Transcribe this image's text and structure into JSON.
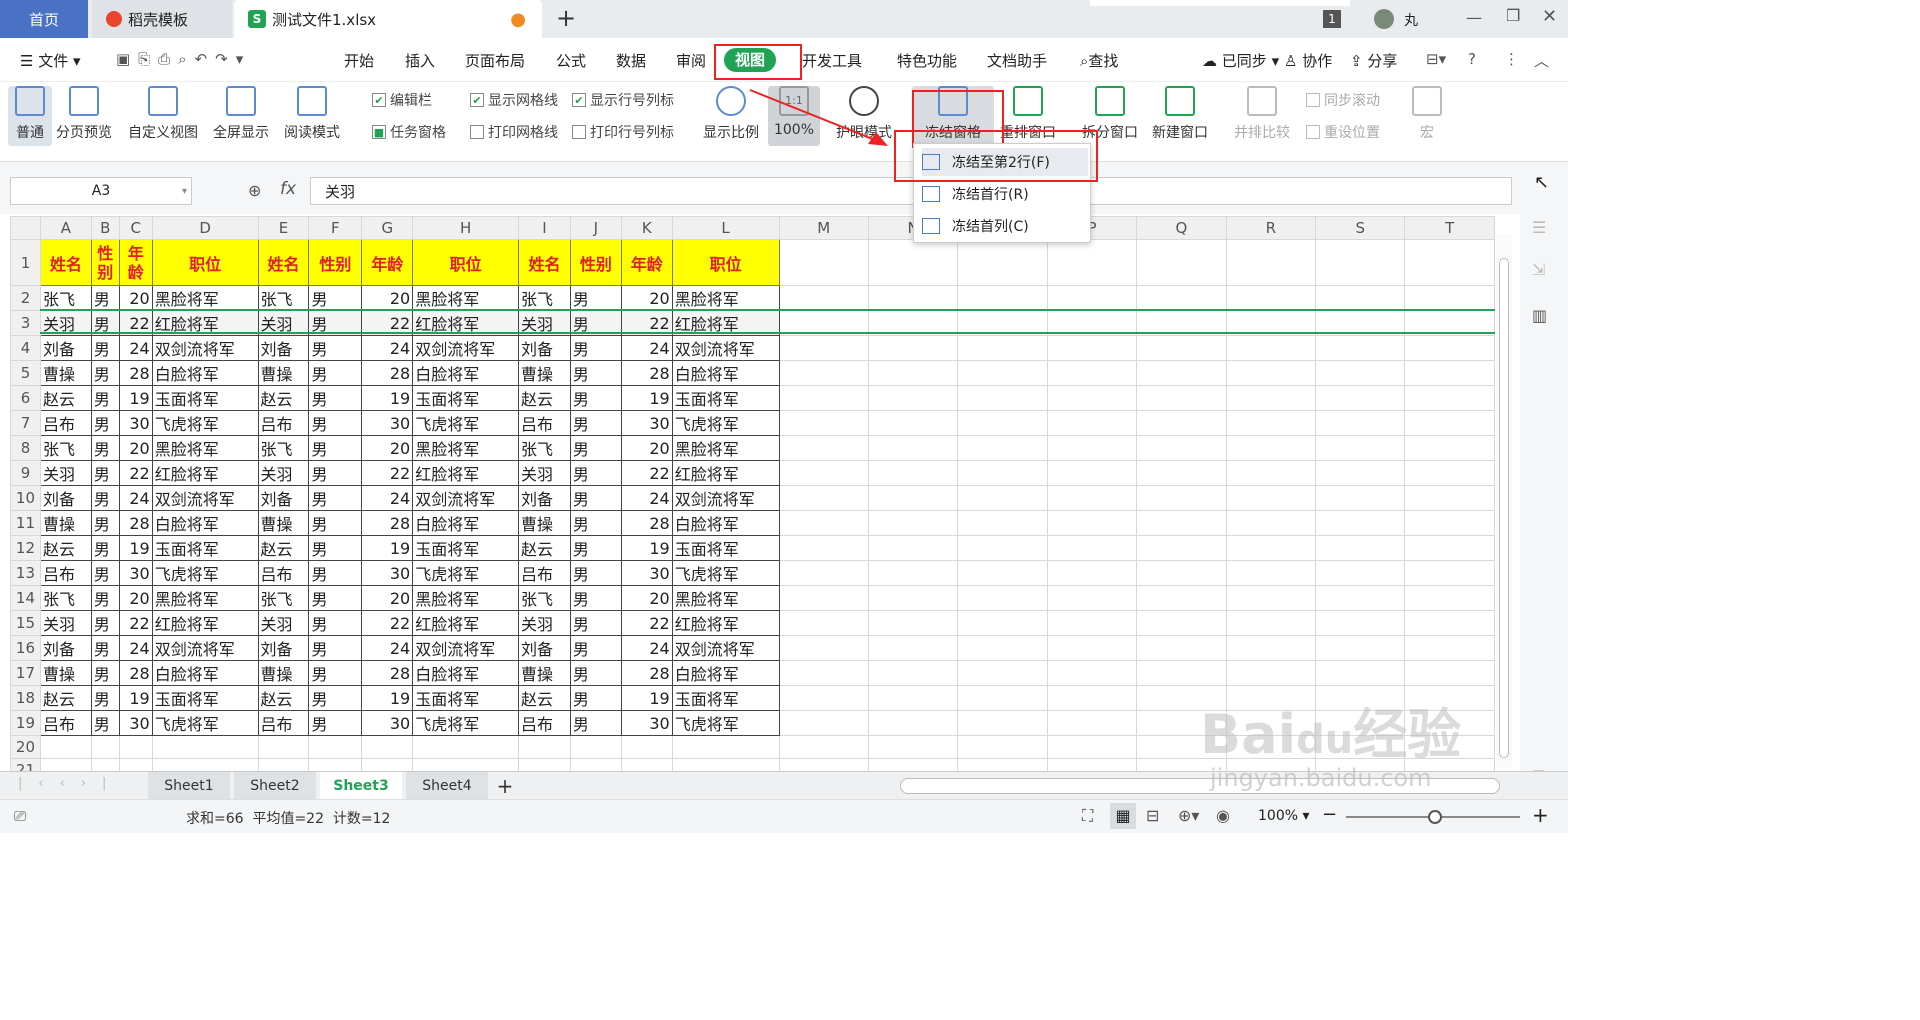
{
  "tabs": {
    "home": "首页",
    "template": "稻壳模板",
    "file": "测试文件1.xlsx",
    "add": "+"
  },
  "titlebar": {
    "badge": "1",
    "user": "丸"
  },
  "menu": {
    "file": "文件",
    "items": [
      "开始",
      "插入",
      "页面布局",
      "公式",
      "数据",
      "审阅",
      "视图",
      "开发工具",
      "特色功能",
      "文档助手",
      "查找"
    ],
    "right": [
      "已同步",
      "协作",
      "分享"
    ]
  },
  "ribbon": {
    "normal": "普通",
    "page_break": "分页预览",
    "custom_view": "自定义视图",
    "fullscreen": "全屏显示",
    "reading": "阅读模式",
    "check_editbar": "编辑栏",
    "check_taskpane": "任务窗格",
    "check_gridlines": "显示网格线",
    "check_printgrid": "打印网格线",
    "check_rowcol": "显示行号列标",
    "check_printrowcol": "打印行号列标",
    "zoom": "显示比例",
    "zoom100": "100%",
    "zoom_icon": "1:1",
    "eye": "护眼模式",
    "freeze": "冻结窗格",
    "arrange": "重排窗口",
    "split": "拆分窗口",
    "new_window": "新建窗口",
    "compare": "并排比较",
    "sync_scroll": "同步滚动",
    "reset_pos": "重设位置",
    "macro": "宏"
  },
  "formula": {
    "cell_ref": "A3",
    "fx": "fx",
    "value": "关羽"
  },
  "dropdown": [
    "冻结至第2行(F)",
    "冻结首行(R)",
    "冻结首列(C)"
  ],
  "columns": [
    "A",
    "B",
    "C",
    "D",
    "E",
    "F",
    "G",
    "H",
    "I",
    "J",
    "K",
    "L",
    "M",
    "N",
    "O",
    "P",
    "Q",
    "R",
    "S",
    "T"
  ],
  "header_row": [
    "姓名",
    "性别",
    "年龄",
    "职位",
    "姓名",
    "性别",
    "年龄",
    "职位",
    "姓名",
    "性别",
    "年龄",
    "职位"
  ],
  "rows": [
    [
      "张飞",
      "男",
      "20",
      "黑脸将军"
    ],
    [
      "关羽",
      "男",
      "22",
      "红脸将军"
    ],
    [
      "刘备",
      "男",
      "24",
      "双剑流将军"
    ],
    [
      "曹操",
      "男",
      "28",
      "白脸将军"
    ],
    [
      "赵云",
      "男",
      "19",
      "玉面将军"
    ],
    [
      "吕布",
      "男",
      "30",
      "飞虎将军"
    ],
    [
      "张飞",
      "男",
      "20",
      "黑脸将军"
    ],
    [
      "关羽",
      "男",
      "22",
      "红脸将军"
    ],
    [
      "刘备",
      "男",
      "24",
      "双剑流将军"
    ],
    [
      "曹操",
      "男",
      "28",
      "白脸将军"
    ],
    [
      "赵云",
      "男",
      "19",
      "玉面将军"
    ],
    [
      "吕布",
      "男",
      "30",
      "飞虎将军"
    ],
    [
      "张飞",
      "男",
      "20",
      "黑脸将军"
    ],
    [
      "关羽",
      "男",
      "22",
      "红脸将军"
    ],
    [
      "刘备",
      "男",
      "24",
      "双剑流将军"
    ],
    [
      "曹操",
      "男",
      "28",
      "白脸将军"
    ],
    [
      "赵云",
      "男",
      "19",
      "玉面将军"
    ],
    [
      "吕布",
      "男",
      "30",
      "飞虎将军"
    ]
  ],
  "sheets": [
    "Sheet1",
    "Sheet2",
    "Sheet3",
    "Sheet4"
  ],
  "active_sheet": "Sheet3",
  "status": {
    "stats": "求和=66  平均值=22  计数=12",
    "zoom": "100%"
  },
  "watermark": "Baidu经验 jingyan.baidu.com",
  "colors": {
    "accent": "#20a354",
    "header_fill": "#ffff00",
    "header_text": "#e02020",
    "highlight": "#ee2222"
  }
}
